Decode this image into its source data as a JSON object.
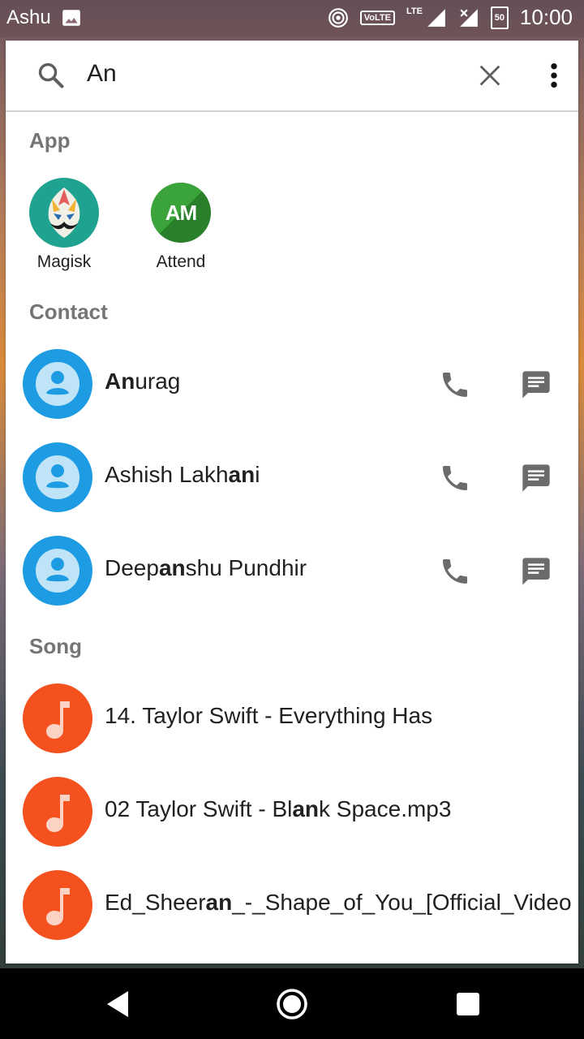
{
  "status_bar": {
    "user": "Ashu",
    "volte": "VoLTE",
    "network": "LTE",
    "battery": "50",
    "time": "10:00"
  },
  "search": {
    "query": "An",
    "icons": [
      "search-icon",
      "close-icon",
      "more-vert-icon"
    ]
  },
  "sections": {
    "app": "App",
    "contact": "Contact",
    "song": "Song"
  },
  "apps": [
    {
      "label": "Magisk"
    },
    {
      "label": "Attend",
      "logo_text": "AM"
    }
  ],
  "contacts": [
    {
      "name_parts": [
        "",
        "An",
        "urag"
      ]
    },
    {
      "name_parts": [
        "Ashish Lakh",
        "an",
        "i"
      ]
    },
    {
      "name_parts": [
        "Deep",
        "an",
        "shu Pundhir"
      ]
    }
  ],
  "songs": [
    {
      "title_parts": [
        "14. Taylor Swift - Everything Has",
        "",
        ""
      ]
    },
    {
      "title_parts": [
        "02 Taylor Swift - Bl",
        "an",
        "k Space.mp3"
      ]
    },
    {
      "title_parts": [
        "Ed_Sheer",
        "an",
        "_-_Shape_of_You_[Official_Video"
      ]
    }
  ],
  "colors": {
    "contact_avatar": "#1e9ce3",
    "song_avatar": "#f4511e",
    "attend_green": "#2e8b2e",
    "magisk_teal": "#1fa28f"
  }
}
